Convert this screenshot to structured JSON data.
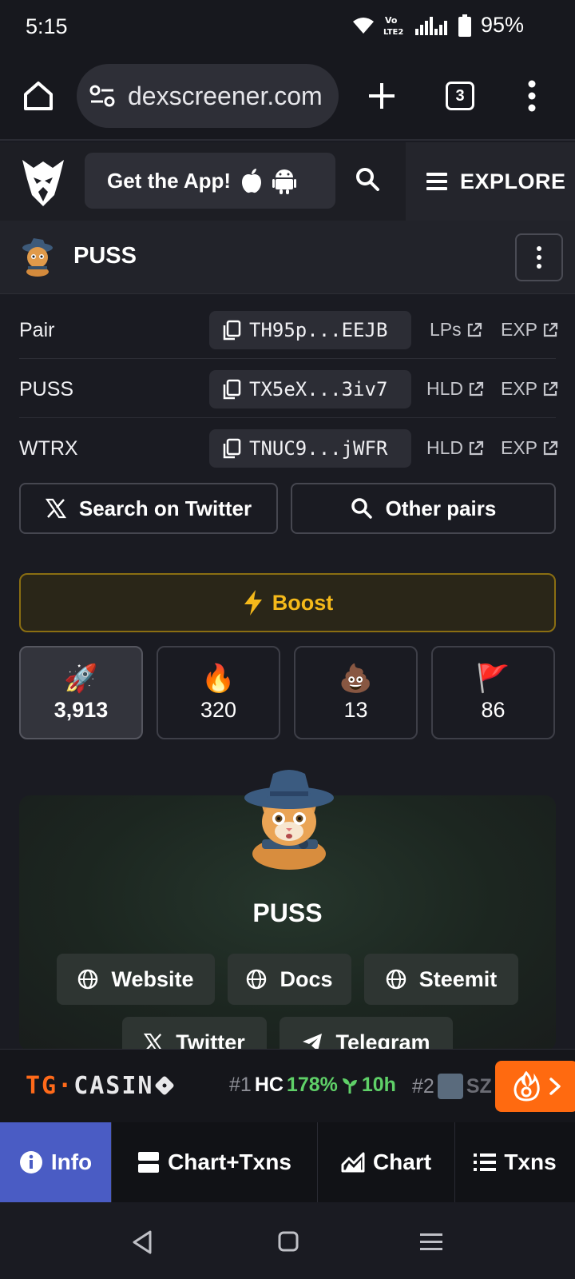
{
  "status_bar": {
    "time": "5:15",
    "network": "Vo LTE2",
    "battery": "95%"
  },
  "browser": {
    "url": "dexscreener.com",
    "tab_count": "3"
  },
  "header": {
    "get_app_label": "Get the App!",
    "explore_label": "EXPLORE"
  },
  "token": {
    "name": "PUSS"
  },
  "addresses": [
    {
      "label": "Pair",
      "value": "TH95p...EEJB",
      "link1": "LPs",
      "link2": "EXP"
    },
    {
      "label": "PUSS",
      "value": "TX5eX...3iv7",
      "link1": "HLD",
      "link2": "EXP"
    },
    {
      "label": "WTRX",
      "value": "TNUC9...jWFR",
      "link1": "HLD",
      "link2": "EXP"
    }
  ],
  "actions": {
    "search_twitter": "Search on Twitter",
    "other_pairs": "Other pairs",
    "boost": "Boost"
  },
  "reactions": [
    {
      "icon": "🚀",
      "count": "3,913"
    },
    {
      "icon": "🔥",
      "count": "320"
    },
    {
      "icon": "💩",
      "count": "13"
    },
    {
      "icon": "🚩",
      "count": "86"
    }
  ],
  "info_card": {
    "title": "PUSS",
    "links": [
      "Website",
      "Docs",
      "Steemit",
      "Twitter",
      "Telegram"
    ]
  },
  "ticker": {
    "brand_left": "TG",
    "brand_right": "CASIN",
    "items": [
      {
        "rank": "#1",
        "symbol": "HC",
        "change": "178%",
        "timeframe": "10h"
      },
      {
        "rank": "#2",
        "symbol": "SZ"
      }
    ]
  },
  "tabs": [
    "Info",
    "Chart+Txns",
    "Chart",
    "Txns"
  ],
  "colors": {
    "accent_blue": "#4a5cc4",
    "boost_gold": "#f5b91a",
    "positive_green": "#5fd068",
    "hot_orange": "#ff6a10"
  }
}
